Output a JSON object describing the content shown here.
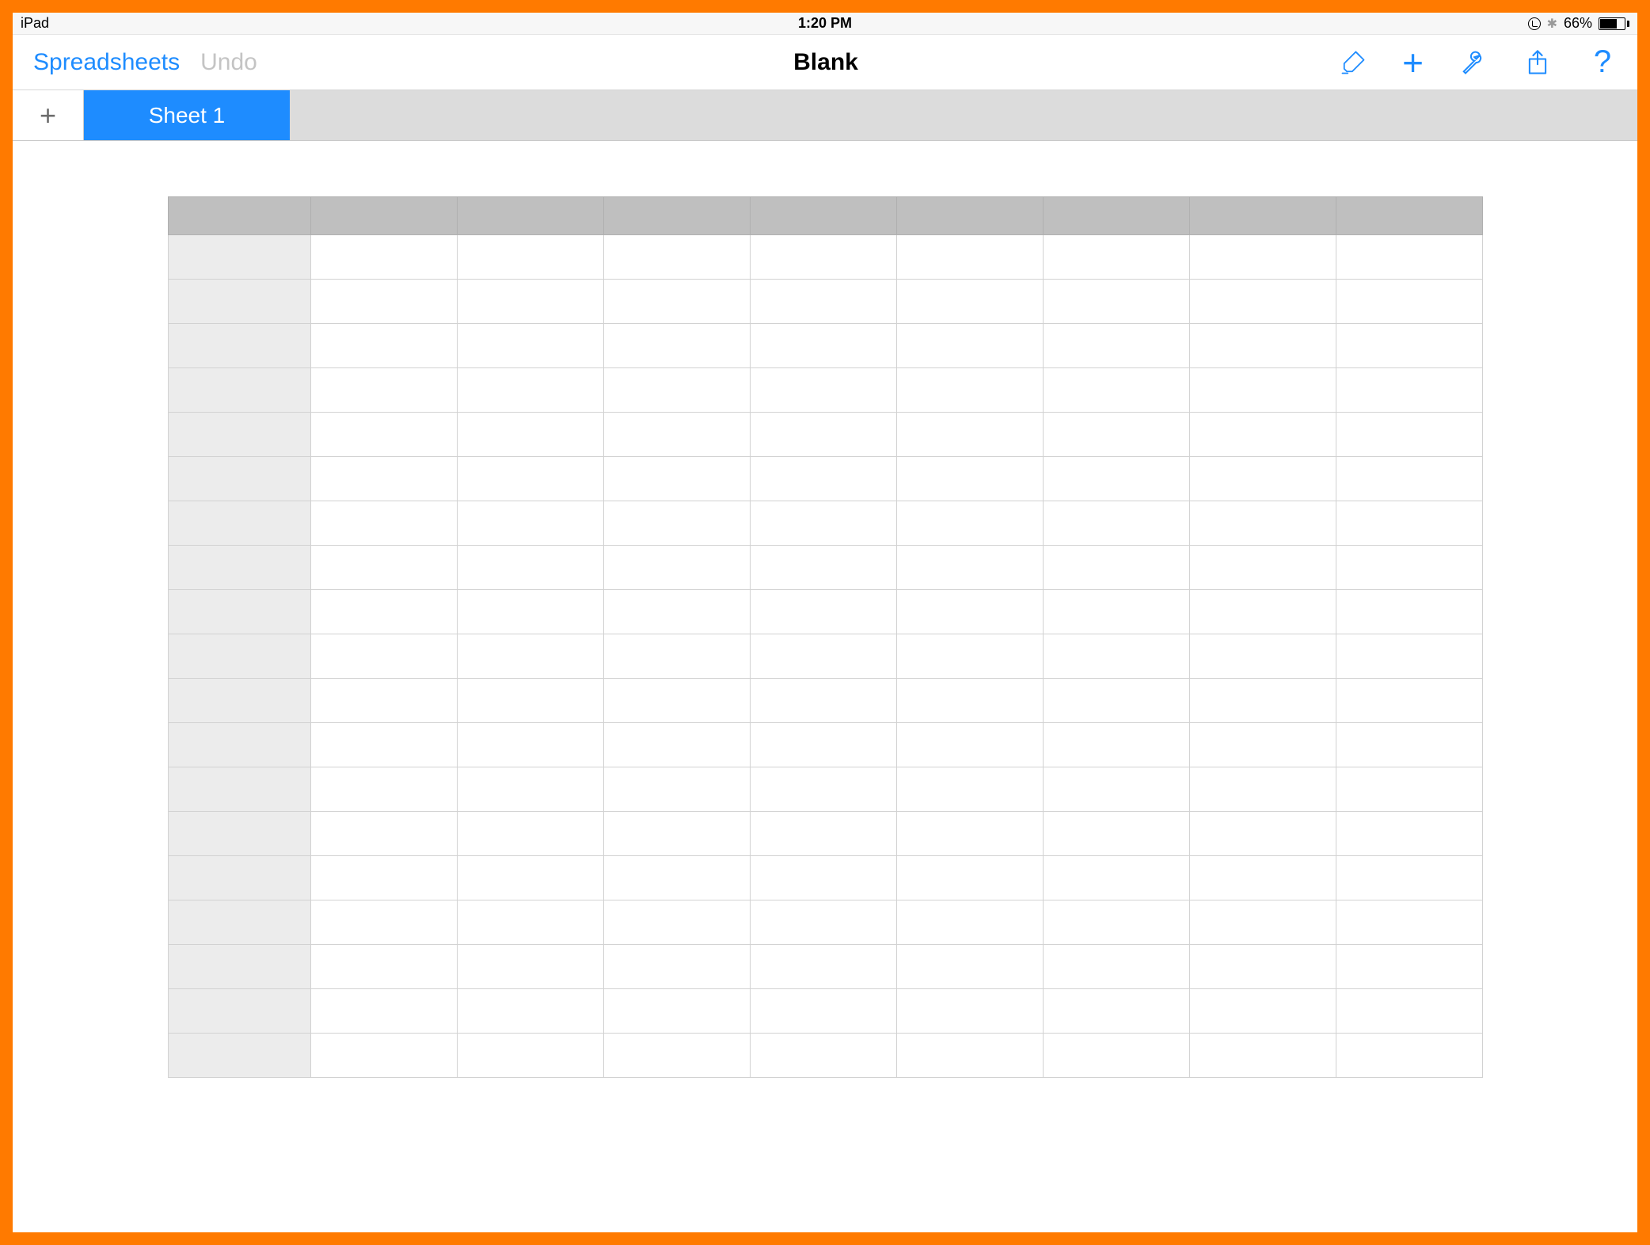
{
  "status": {
    "device": "iPad",
    "time": "1:20 PM",
    "battery_pct": "66%"
  },
  "toolbar": {
    "back_label": "Spreadsheets",
    "undo_label": "Undo",
    "title": "Blank",
    "icons": {
      "brush": "format-brush-icon",
      "add": "add-icon",
      "wrench": "tools-icon",
      "share": "share-icon",
      "help": "help-icon"
    },
    "help_glyph": "?"
  },
  "sheets": {
    "add_glyph": "+",
    "tabs": [
      {
        "label": "Sheet 1",
        "active": true
      }
    ]
  },
  "grid": {
    "columns": 9,
    "rows": 19
  },
  "colors": {
    "accent": "#1e8cff",
    "frame": "#ff7a00"
  }
}
